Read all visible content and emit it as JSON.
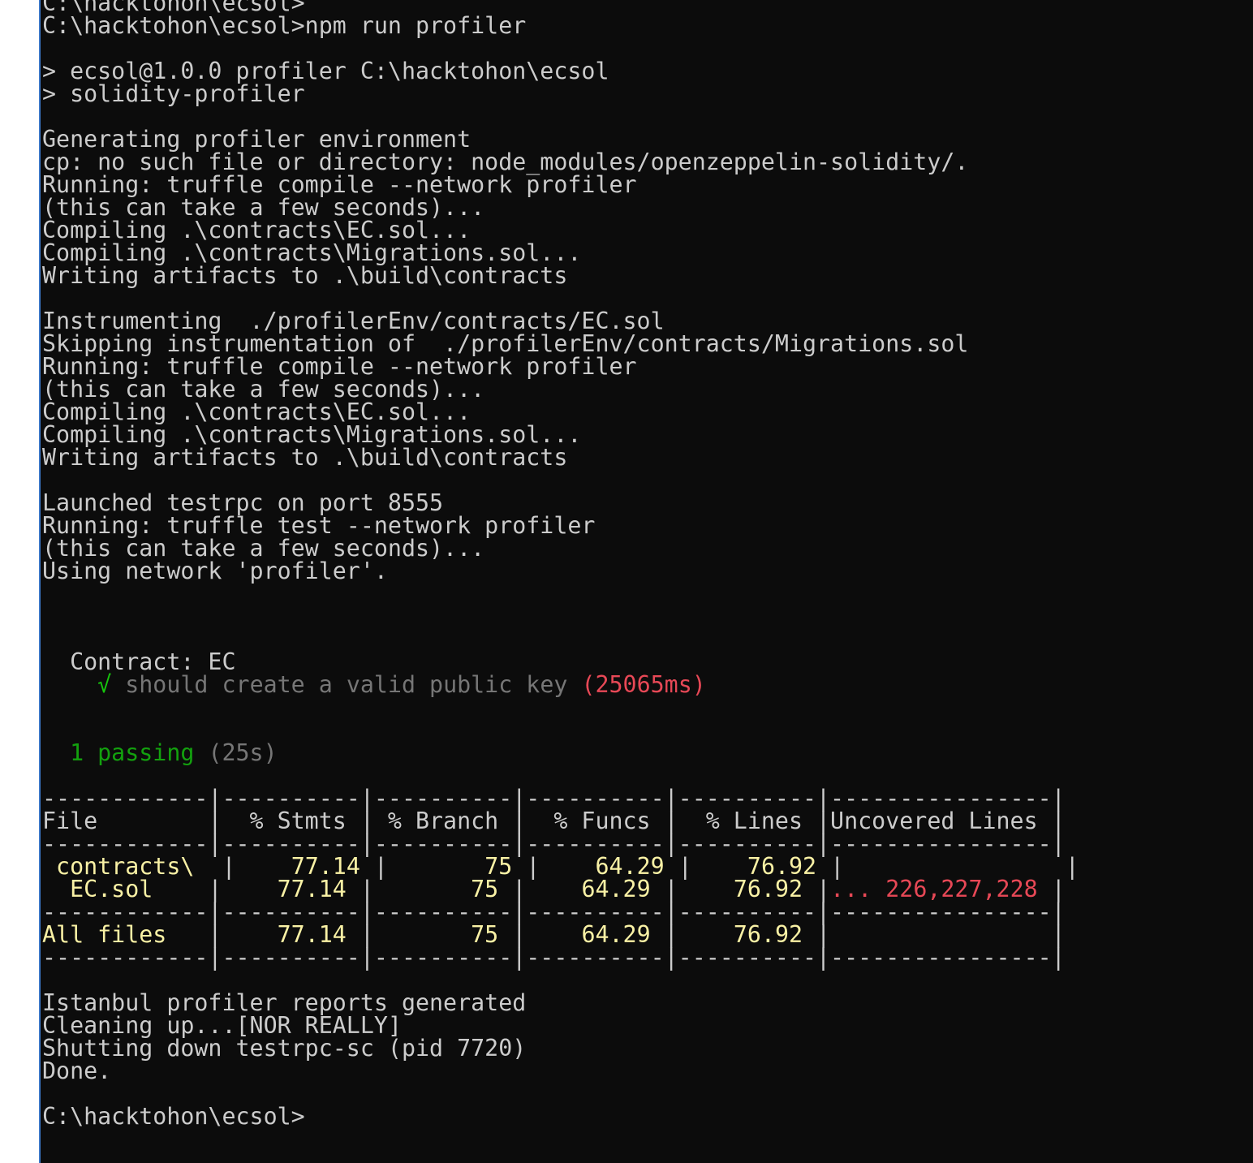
{
  "colors": {
    "background": "#0c0c0c",
    "foreground": "#cccccc",
    "check_green": "#16c60c",
    "passing_green": "#13a10e",
    "gray": "#767676",
    "red": "#e74856",
    "yellow": "#f9f1a5",
    "window_border": "#3c78c8"
  },
  "console": {
    "lines": [
      [
        {
          "t": "C:\\hacktohon\\ecsol>"
        }
      ],
      [
        {
          "t": "C:\\hacktohon\\ecsol>npm run profiler"
        }
      ],
      [],
      [
        {
          "t": "> ecsol@1.0.0 profiler C:\\hacktohon\\ecsol"
        }
      ],
      [
        {
          "t": "> solidity-profiler"
        }
      ],
      [],
      [
        {
          "t": "Generating profiler environment"
        }
      ],
      [
        {
          "t": "cp: no such file or directory: node_modules/openzeppelin-solidity/."
        }
      ],
      [
        {
          "t": "Running: truffle compile --network profiler"
        }
      ],
      [
        {
          "t": "(this can take a few seconds)..."
        }
      ],
      [
        {
          "t": "Compiling .\\contracts\\EC.sol..."
        }
      ],
      [
        {
          "t": "Compiling .\\contracts\\Migrations.sol..."
        }
      ],
      [
        {
          "t": "Writing artifacts to .\\build\\contracts"
        }
      ],
      [],
      [
        {
          "t": "Instrumenting  ./profilerEnv/contracts/EC.sol"
        }
      ],
      [
        {
          "t": "Skipping instrumentation of  ./profilerEnv/contracts/Migrations.sol"
        }
      ],
      [
        {
          "t": "Running: truffle compile --network profiler"
        }
      ],
      [
        {
          "t": "(this can take a few seconds)..."
        }
      ],
      [
        {
          "t": "Compiling .\\contracts\\EC.sol..."
        }
      ],
      [
        {
          "t": "Compiling .\\contracts\\Migrations.sol..."
        }
      ],
      [
        {
          "t": "Writing artifacts to .\\build\\contracts"
        }
      ],
      [],
      [
        {
          "t": "Launched testrpc on port 8555"
        }
      ],
      [
        {
          "t": "Running: truffle test --network profiler"
        }
      ],
      [
        {
          "t": "(this can take a few seconds)..."
        }
      ],
      [
        {
          "t": "Using network 'profiler'."
        }
      ],
      [],
      [],
      [],
      [
        {
          "t": "  Contract: EC"
        }
      ],
      [
        {
          "t": "    "
        },
        {
          "t": "√",
          "c": "green"
        },
        {
          "t": " should create a valid public key",
          "c": "gray"
        },
        {
          "t": " (25065ms)",
          "c": "red"
        }
      ],
      [],
      [],
      [
        {
          "t": "  "
        },
        {
          "t": "1 passing",
          "c": "darkgreen"
        },
        {
          "t": " (25s)",
          "c": "gray"
        }
      ],
      [],
      [
        {
          "t": "------------|----------|----------|----------|----------|----------------|"
        }
      ],
      [
        {
          "t": "File        |  % Stmts | % Branch |  % Funcs |  % Lines |Uncovered Lines |"
        }
      ],
      [
        {
          "t": "------------|----------|----------|----------|----------|----------------|"
        }
      ],
      [
        {
          "t": " "
        },
        {
          "t": "contracts\\",
          "c": "yellow"
        },
        {
          "t": "  |    "
        },
        {
          "t": "77.14",
          "c": "yellow"
        },
        {
          "t": " |       "
        },
        {
          "t": "75",
          "c": "yellow"
        },
        {
          "t": " |    "
        },
        {
          "t": "64.29",
          "c": "yellow"
        },
        {
          "t": " |    "
        },
        {
          "t": "76.92",
          "c": "yellow"
        },
        {
          "t": " |                |"
        }
      ],
      [
        {
          "t": "  "
        },
        {
          "t": "EC.sol",
          "c": "yellow"
        },
        {
          "t": "    |    "
        },
        {
          "t": "77.14",
          "c": "yellow"
        },
        {
          "t": " |       "
        },
        {
          "t": "75",
          "c": "yellow"
        },
        {
          "t": " |    "
        },
        {
          "t": "64.29",
          "c": "yellow"
        },
        {
          "t": " |    "
        },
        {
          "t": "76.92",
          "c": "yellow"
        },
        {
          "t": " |"
        },
        {
          "t": "... 226,227,228",
          "c": "red"
        },
        {
          "t": " |"
        }
      ],
      [
        {
          "t": "------------|----------|----------|----------|----------|----------------|"
        }
      ],
      [
        {
          "t": "All files",
          "c": "yellow"
        },
        {
          "t": "   |    "
        },
        {
          "t": "77.14",
          "c": "yellow"
        },
        {
          "t": " |       "
        },
        {
          "t": "75",
          "c": "yellow"
        },
        {
          "t": " |    "
        },
        {
          "t": "64.29",
          "c": "yellow"
        },
        {
          "t": " |    "
        },
        {
          "t": "76.92",
          "c": "yellow"
        },
        {
          "t": " |                |"
        }
      ],
      [
        {
          "t": "------------|----------|----------|----------|----------|----------------|"
        }
      ],
      [],
      [
        {
          "t": "Istanbul profiler reports generated"
        }
      ],
      [
        {
          "t": "Cleaning up...[NOR REALLY]"
        }
      ],
      [
        {
          "t": "Shutting down testrpc-sc (pid 7720)"
        }
      ],
      [
        {
          "t": "Done."
        }
      ],
      [],
      [
        {
          "t": "C:\\hacktohon\\ecsol>"
        }
      ]
    ]
  }
}
